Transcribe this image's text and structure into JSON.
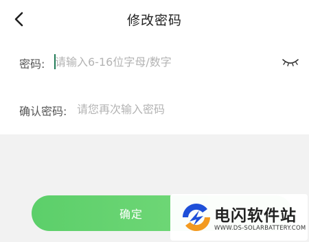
{
  "header": {
    "title": "修改密码",
    "back_icon": "chevron-left-icon"
  },
  "form": {
    "password": {
      "label": "密码:",
      "placeholder": "请输入6-16位字母/数字",
      "value": "",
      "visibility_icon": "eye-closed-icon"
    },
    "confirm_password": {
      "label": "确认密码:",
      "placeholder": "请您再次输入密码",
      "value": ""
    }
  },
  "actions": {
    "confirm_label": "确定"
  },
  "watermark": {
    "name": "电闪软件站",
    "url": "WWW.DS-SOLARBATTERY.COM"
  },
  "colors": {
    "accent": "#5ccf6a",
    "cursor": "#1f7a55",
    "logo_blue": "#1e4fd8",
    "logo_orange": "#f39a1f"
  }
}
